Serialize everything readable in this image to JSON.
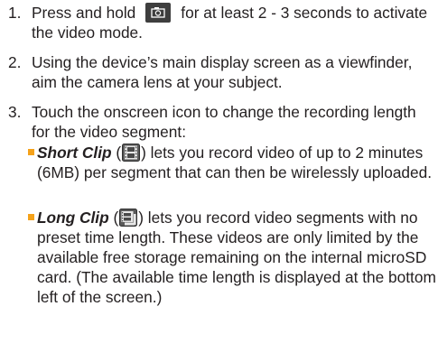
{
  "steps": [
    {
      "number": "1.",
      "text_before_icon": "Press and hold",
      "icon": "camera-key-icon",
      "text_after_icon": "for at least 2 - 3 seconds to activate the video mode."
    },
    {
      "number": "2.",
      "text": "Using the device’s main display screen as a viewfinder, aim the camera lens at your subject."
    },
    {
      "number": "3.",
      "text": "Touch the onscreen icon to change the recording length for the video segment:",
      "options": [
        {
          "term": "Short Clip",
          "open_paren": " (",
          "icon": "short-clip-icon",
          "rest": ") lets you record video of up to 2 minutes (6MB) per segment that can then be wirelessly uploaded."
        },
        {
          "term": "Long Clip",
          "open_paren": " (",
          "icon": "long-clip-icon",
          "rest": ") lets you record video segments with no preset time length. These videos are only limited by the available free storage remaining on the internal microSD card. (The available time length is displayed at the bottom left of the screen.)"
        }
      ]
    }
  ],
  "colors": {
    "text": "#231f20",
    "bullet": "#f5a21a",
    "key_background": "#3e3e3e"
  }
}
